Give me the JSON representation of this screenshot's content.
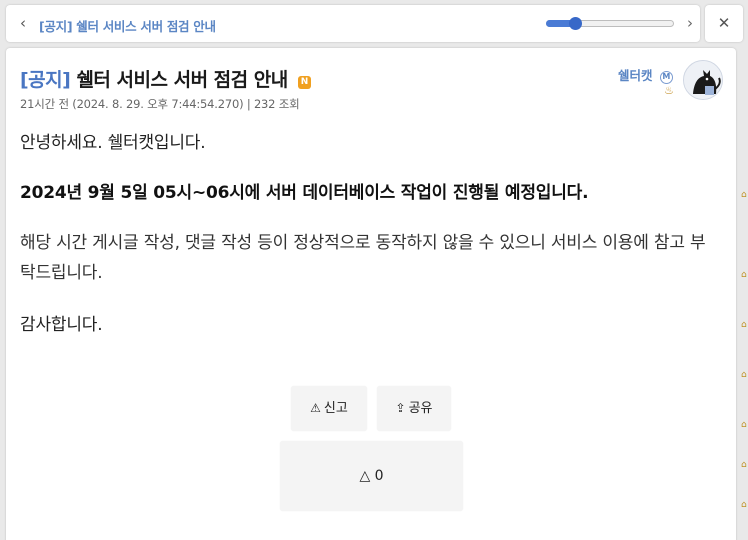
{
  "topbar": {
    "title": "[공지] 쉘터 서비스 서버 점검 안내",
    "back_icon": "chevron-left-icon",
    "next_icon": "chevron-right-icon",
    "slider_value": 0.23
  },
  "close_label": "✕",
  "post": {
    "title_prefix": "[공지]",
    "title": "쉘터 서비스 서버 점검 안내",
    "new_badge": "N",
    "meta": "21시간 전 (2024. 8. 29. 오후 7:44:54.270) | 232 조회",
    "author": "쉘터캣",
    "author_mod_icon": "M",
    "paragraphs": [
      "안녕하세요. 쉘터캣입니다.",
      "2024년 9월 5일 05시~06시에 서버 데이터베이스 작업이 진행될 예정입니다.",
      "해당 시간 게시글 작성, 댓글 작성 등이 정상적으로 동작하지 않을 수 있으니 서비스 이용에 참고 부탁드립니다.",
      "감사합니다."
    ]
  },
  "actions": {
    "report_label": "신고",
    "share_label": "공유",
    "vote_label": "△ 0"
  },
  "colors": {
    "accent": "#5b86c4",
    "badge": "#f0a020",
    "slider": "#4a7bd5"
  }
}
